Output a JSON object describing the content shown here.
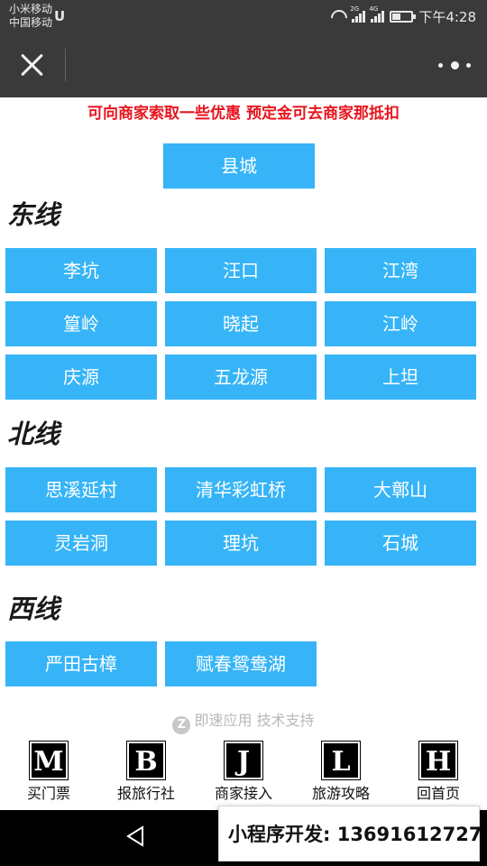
{
  "status_bar": {
    "carrier_1": "小米移动",
    "carrier_2": "中国移动",
    "carrier_logo": "U",
    "net_1": "2G",
    "net_2": "4G",
    "time": "下午4:28"
  },
  "nav": {
    "close_icon": "close-icon",
    "more_icon": "more-icon"
  },
  "notice": "可向商家索取一些优惠 预定金可去商家那抵扣",
  "county": "县城",
  "sections": [
    {
      "title": "东线",
      "items": [
        "李坑",
        "汪口",
        "江湾",
        "篁岭",
        "晓起",
        "江岭",
        "庆源",
        "五龙源",
        "上坦"
      ]
    },
    {
      "title": "北线",
      "items": [
        "思溪延村",
        "清华彩虹桥",
        "大鄣山",
        "灵岩洞",
        "理坑",
        "石城"
      ]
    },
    {
      "title": "西线",
      "items": [
        "严田古樟",
        "赋春鸳鸯湖"
      ]
    }
  ],
  "footer": {
    "tech_support": "即速应用 技术支持",
    "logo_icon": "z-logo-icon"
  },
  "tabs": [
    {
      "letter": "M",
      "label": "买门票"
    },
    {
      "letter": "B",
      "label": "报旅行社"
    },
    {
      "letter": "J",
      "label": "商家接入"
    },
    {
      "letter": "L",
      "label": "旅游攻略"
    },
    {
      "letter": "H",
      "label": "回首页"
    }
  ],
  "promo": "小程序开发: 13691612727",
  "colors": {
    "button": "#36b4f7",
    "notice": "#e8141e",
    "bar": "#3a3a3a"
  },
  "battery_level": 0.45
}
